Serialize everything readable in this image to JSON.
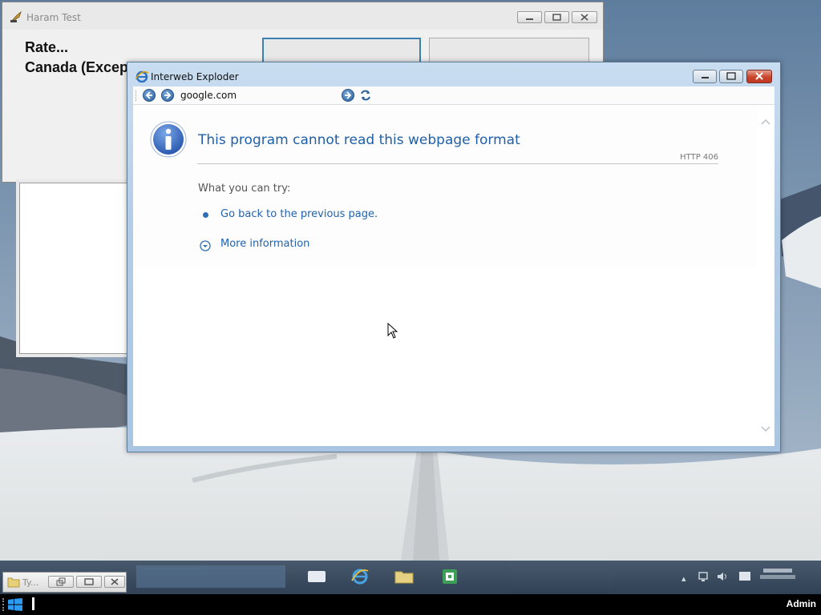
{
  "background_window": {
    "title": "Haram Test",
    "text_line1": "Rate...",
    "text_line2": "Canada (Excep"
  },
  "browser": {
    "title": "Interweb Exploder",
    "address": "google.com",
    "error": {
      "title": "This program cannot read this webpage format",
      "code": "HTTP 406",
      "what_you_can_try": "What you can try:",
      "go_back_link": "Go back to the previous page.",
      "more_info_link": "More information"
    }
  },
  "taskbar": {
    "minimized_window_title": "Ty...",
    "user": "Admin"
  },
  "colors": {
    "accent": "#1f62b0",
    "titlebar": "#b9d1ea",
    "taskbar": "#2a3c52"
  }
}
